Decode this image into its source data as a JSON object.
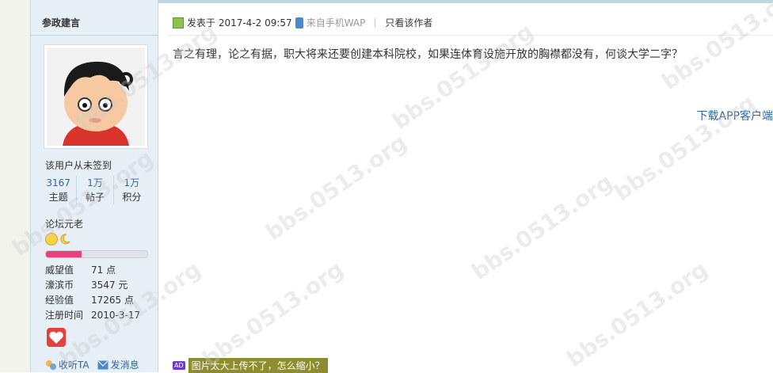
{
  "author": {
    "name": "参政建言",
    "signin_status": "该用户从未签到",
    "stats": [
      {
        "value": "3167",
        "label": "主题"
      },
      {
        "value": "1万",
        "label": "帖子"
      },
      {
        "value": "1万",
        "label": "积分"
      }
    ],
    "rank": "论坛元老",
    "rank_progress": 0.35,
    "meta": [
      {
        "key": "威望值",
        "value": "71 点"
      },
      {
        "key": "濠滨币",
        "value": "3547 元"
      },
      {
        "key": "经验值",
        "value": "17265 点"
      },
      {
        "key": "注册时间",
        "value": "2010-3-17"
      }
    ],
    "actions": {
      "follow": "收听TA",
      "message": "发消息"
    }
  },
  "post": {
    "posted_at": "发表于 2017-4-2 09:57",
    "source": "来自手机WAP",
    "only_author": "只看该作者",
    "content": "言之有理，论之有据，职大将来还要创建本科院校，如果连体育设施开放的胸襟都没有，何谈大学二字？",
    "app_link": "下载APP客户端"
  },
  "ad": {
    "badge": "AD",
    "text": "图片太大上传不了，怎么缩小？"
  },
  "watermark": "bbs.0513.org"
}
